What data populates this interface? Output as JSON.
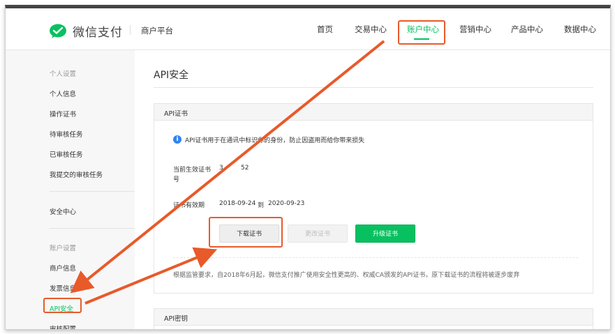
{
  "header": {
    "logo_text": "微信支付",
    "platform": "商户平台",
    "nav": [
      {
        "label": "首页"
      },
      {
        "label": "交易中心"
      },
      {
        "label": "账户中心",
        "active": true
      },
      {
        "label": "营销中心"
      },
      {
        "label": "产品中心"
      },
      {
        "label": "数据中心"
      }
    ]
  },
  "sidebar": {
    "groups": {
      "personal": "个人设置",
      "account": "账户设置"
    },
    "items": [
      {
        "label": "个人信息"
      },
      {
        "label": "操作证书"
      },
      {
        "label": "待审核任务"
      },
      {
        "label": "已审核任务"
      },
      {
        "label": "我提交的审核任务"
      },
      {
        "label": "安全中心"
      },
      {
        "label": "商户信息"
      },
      {
        "label": "发票信息"
      },
      {
        "label": "API安全",
        "active": true
      },
      {
        "label": "审核配置"
      }
    ]
  },
  "main": {
    "title": "API安全",
    "cert_card": {
      "heading": "API证书",
      "info": "API证书用于在通讯中标识你的身份，防止因盗用而给你带来损失",
      "current_cert_label": "当前生效证书",
      "current_cert_label_2": "号",
      "current_cert_value_a": "3",
      "current_cert_value_b": "52",
      "validity_label": "证书有效期",
      "validity_from": "2018-09-24",
      "validity_to_word": "到",
      "validity_to": "2020-09-23",
      "buttons": {
        "download": "下载证书",
        "change": "更改证书",
        "upgrade": "升级证书"
      },
      "notice": "根据监管要求，自2018年6月起，微信支付推广使用安全性更高的、权威CA颁发的API证书，原下载证书的流程将被逐步废弃"
    },
    "key_card": {
      "heading": "API密钥"
    }
  },
  "colors": {
    "accent": "#07c160",
    "annotation": "#e85a2a",
    "info": "#2f85f3"
  }
}
